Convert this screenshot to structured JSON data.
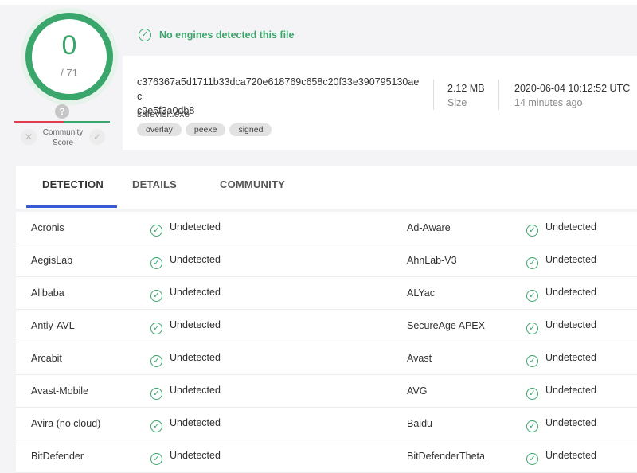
{
  "score": {
    "detected": "0",
    "total": "/ 71",
    "community_label_line1": "Community",
    "community_label_line2": "Score",
    "question_mark": "?",
    "vote_down": "✕",
    "vote_up": "✓"
  },
  "summary": {
    "banner": "No engines detected this file",
    "hash_line1": "c376367a5d1711b33dca720e618769c658c20f33e390795130aec",
    "hash_line2": "c9e5f3a0db8",
    "filename": "safevisit.exe",
    "tags": [
      "overlay",
      "peexe",
      "signed"
    ],
    "size_value": "2.12 MB",
    "size_label": "Size",
    "date_value": "2020-06-04 10:12:52 UTC",
    "date_ago": "14 minutes ago"
  },
  "tabs": [
    "DETECTION",
    "DETAILS",
    "COMMUNITY"
  ],
  "status_label": "Undetected",
  "detections": [
    {
      "left": "Acronis",
      "right": "Ad-Aware"
    },
    {
      "left": "AegisLab",
      "right": "AhnLab-V3"
    },
    {
      "left": "Alibaba",
      "right": "ALYac"
    },
    {
      "left": "Antiy-AVL",
      "right": "SecureAge APEX"
    },
    {
      "left": "Arcabit",
      "right": "Avast"
    },
    {
      "left": "Avast-Mobile",
      "right": "AVG"
    },
    {
      "left": "Avira (no cloud)",
      "right": "Baidu"
    },
    {
      "left": "BitDefender",
      "right": "BitDefenderTheta"
    }
  ],
  "colors": {
    "clean": "#3aa66c",
    "malicious": "#e33d4a",
    "tab_accent": "#3c5ad8"
  }
}
